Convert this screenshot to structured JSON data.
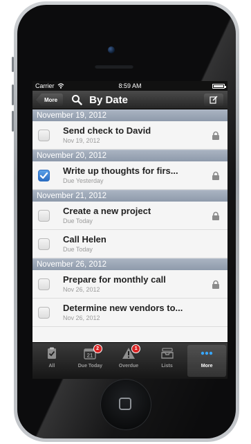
{
  "status_bar": {
    "carrier": "Carrier",
    "time": "8:59 AM"
  },
  "nav": {
    "back_label": "More",
    "title": "By Date"
  },
  "sections": [
    {
      "header": "November 19, 2012",
      "tasks": [
        {
          "title": "Send check to David",
          "subtitle": "Nov 19, 2012",
          "checked": false,
          "locked": true
        }
      ]
    },
    {
      "header": "November 20, 2012",
      "tasks": [
        {
          "title": "Write up thoughts for firs...",
          "subtitle": "Due Yesterday",
          "checked": true,
          "locked": true
        }
      ]
    },
    {
      "header": "November 21, 2012",
      "tasks": [
        {
          "title": "Create a new project",
          "subtitle": "Due Today",
          "checked": false,
          "locked": true
        },
        {
          "title": "Call Helen",
          "subtitle": "Due Today",
          "checked": false,
          "locked": false
        }
      ]
    },
    {
      "header": "November 26, 2012",
      "tasks": [
        {
          "title": "Prepare for monthly call",
          "subtitle": "Nov 26, 2012",
          "checked": false,
          "locked": true
        },
        {
          "title": "Determine new vendors to...",
          "subtitle": "Nov 26, 2012",
          "checked": false,
          "locked": false
        }
      ]
    }
  ],
  "tabs": [
    {
      "label": "All",
      "icon": "clipboard-icon",
      "active": false
    },
    {
      "label": "Due Today",
      "icon": "calendar-icon",
      "calendar_day": "21",
      "badge": "2",
      "active": false
    },
    {
      "label": "Overdue",
      "icon": "warning-icon",
      "badge": "1",
      "active": false
    },
    {
      "label": "Lists",
      "icon": "inbox-tray-icon",
      "active": false
    },
    {
      "label": "More",
      "icon": "more-dots-icon",
      "active": true
    }
  ],
  "colors": {
    "accent_blue": "#2b6dc2",
    "badge_red": "#d92525",
    "section_header": "#8e9aab"
  }
}
